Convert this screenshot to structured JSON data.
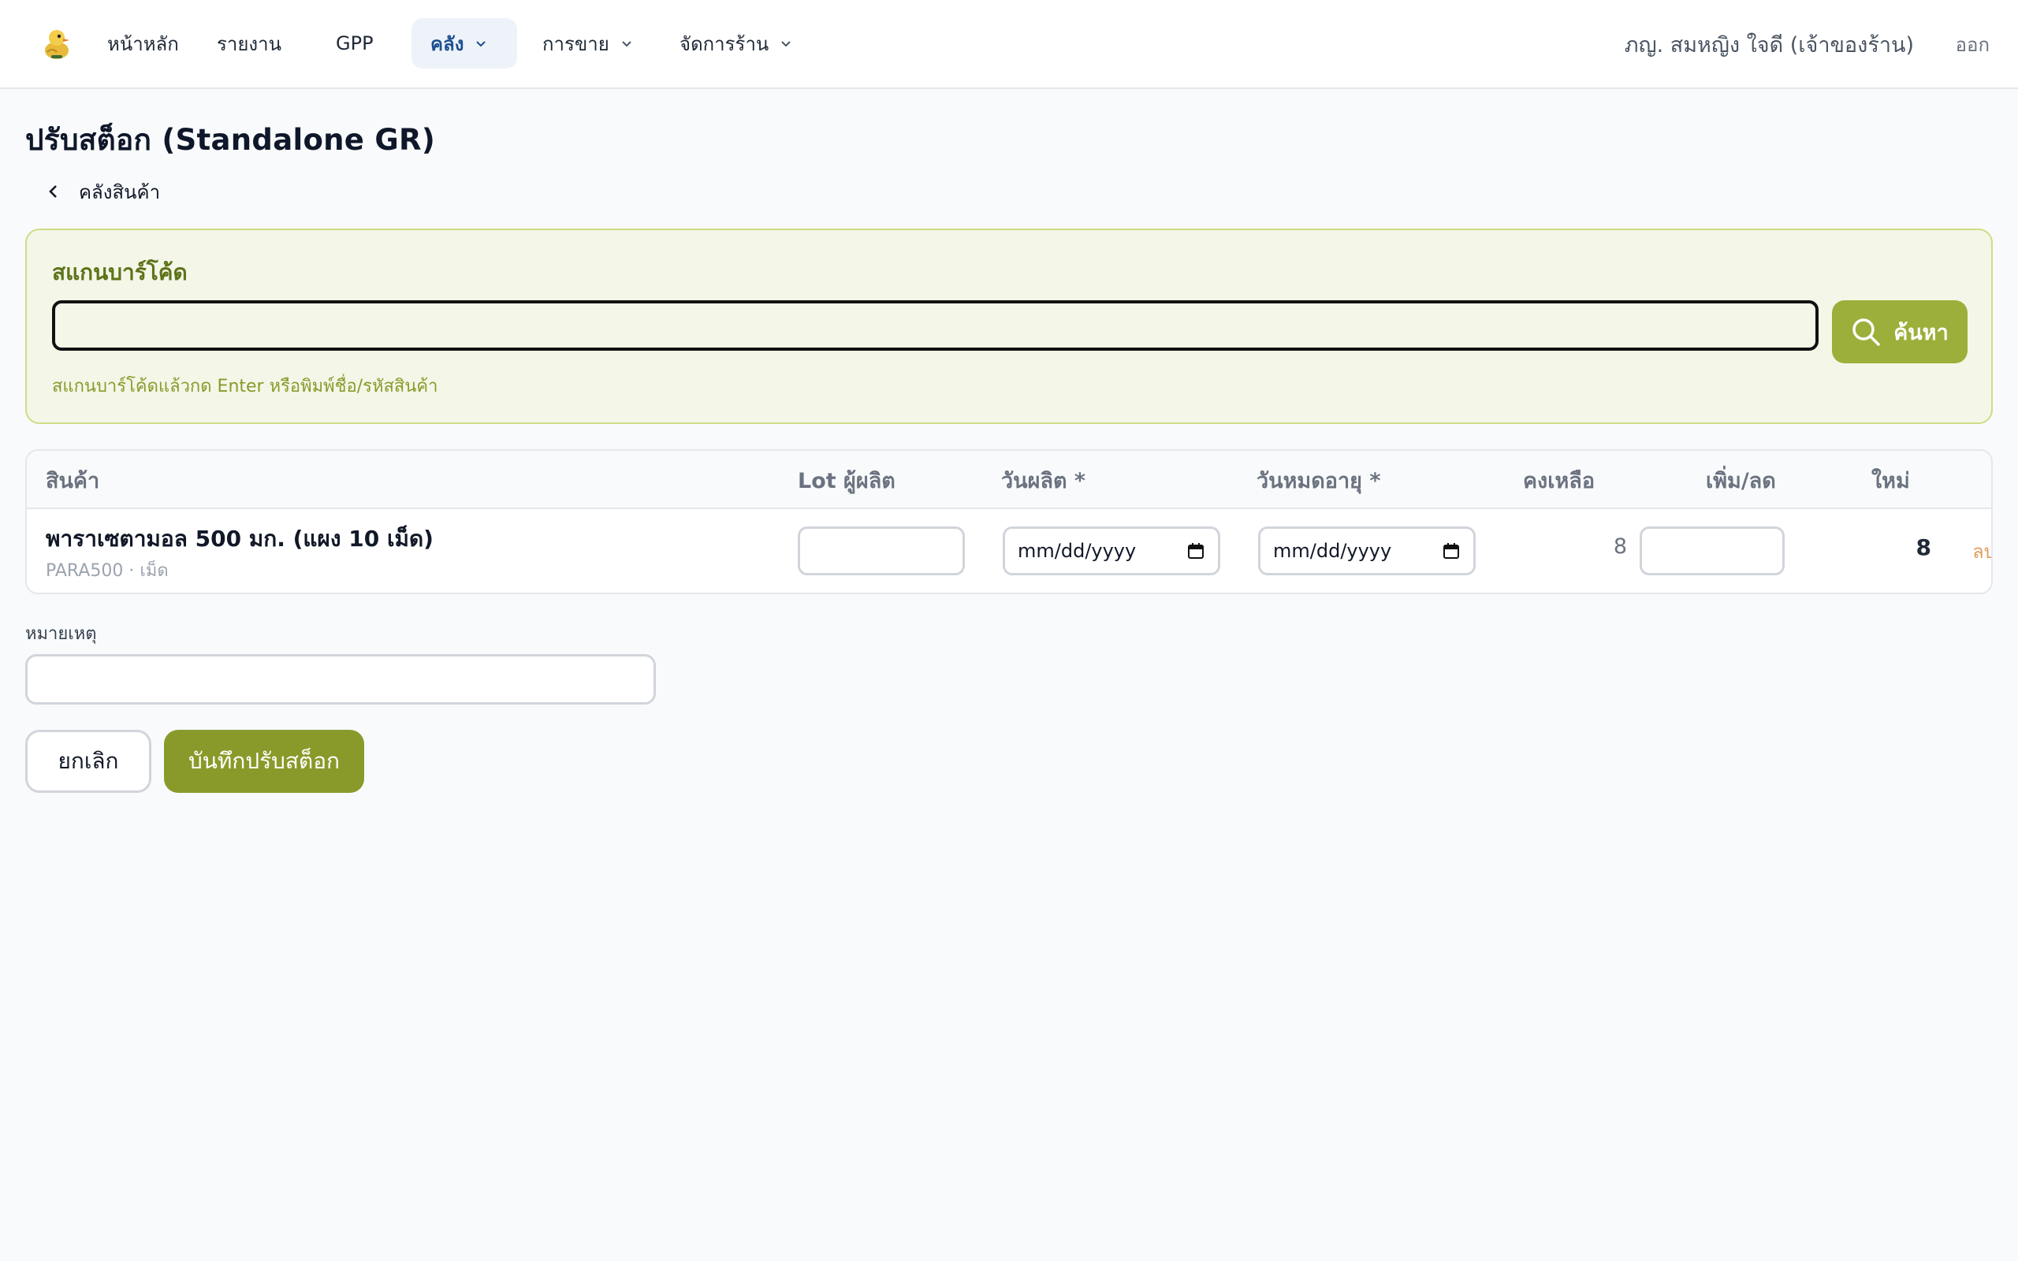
{
  "colors": {
    "accent": "#8a9a2a",
    "accent_light": "#f4f6e8",
    "nav_active_bg": "#eef3fa",
    "nav_active_text": "#1d4f91",
    "danger_text": "#e0a060"
  },
  "nav": {
    "logo_icon": "duck-logo-icon",
    "items": [
      {
        "label": "หน้าหลัก",
        "dropdown": false,
        "active": false
      },
      {
        "label": "รายงาน",
        "dropdown": false,
        "active": false
      },
      {
        "label": "GPP",
        "dropdown": false,
        "active": false
      },
      {
        "label": "คลัง",
        "dropdown": true,
        "active": true
      },
      {
        "label": "การขาย",
        "dropdown": true,
        "active": false
      },
      {
        "label": "จัดการร้าน",
        "dropdown": true,
        "active": false
      }
    ],
    "user": "ภญ. สมหญิง ใจดี (เจ้าของร้าน)",
    "logout": "ออก"
  },
  "page": {
    "title": "ปรับสต็อก (Standalone GR)",
    "back_label": "คลังสินค้า"
  },
  "scan": {
    "label": "สแกนบาร์โค้ด",
    "value": "",
    "button_label": "ค้นหา",
    "hint": "สแกนบาร์โค้ดแล้วกด Enter หรือพิมพ์ชื่อ/รหัสสินค้า"
  },
  "table": {
    "headers": {
      "product": "สินค้า",
      "lot": "Lot ผู้ผลิต",
      "mfg_date": "วันผลิต *",
      "exp_date": "วันหมดอายุ *",
      "remaining": "คงเหลือ",
      "adjust": "เพิ่ม/ลด",
      "new": "ใหม่"
    },
    "rows": [
      {
        "name": "พาราเซตามอล 500 มก. (แผง 10 เม็ด)",
        "meta": "PARA500 · เม็ด",
        "lot": "",
        "mfg_date": "mm/dd/yyyy",
        "exp_date": "mm/dd/yyyy",
        "remaining": "8",
        "adjust": "",
        "new": "8",
        "delete_label": "ลบ"
      }
    ]
  },
  "remark": {
    "label": "หมายเหตุ",
    "value": ""
  },
  "actions": {
    "cancel": "ยกเลิก",
    "save": "บันทึกปรับสต็อก"
  }
}
